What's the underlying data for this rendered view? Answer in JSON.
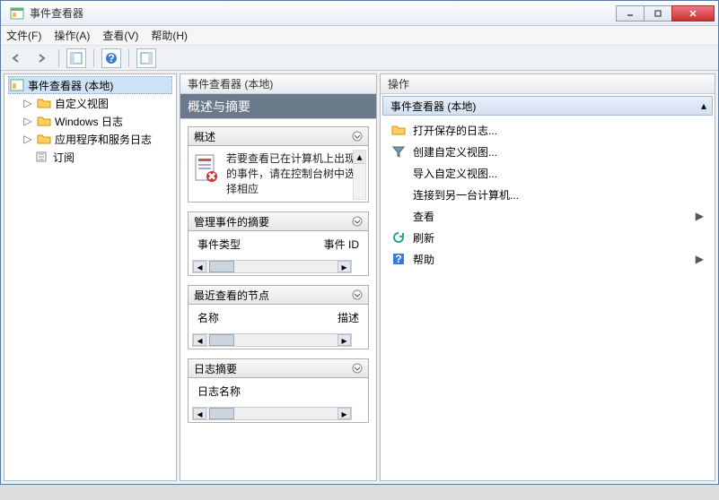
{
  "window": {
    "title": "事件查看器"
  },
  "menu": {
    "file": "文件(F)",
    "action": "操作(A)",
    "view": "查看(V)",
    "help": "帮助(H)"
  },
  "tree": {
    "root": "事件查看器 (本地)",
    "custom_views": "自定义视图",
    "windows_logs": "Windows 日志",
    "app_service_logs": "应用程序和服务日志",
    "subscriptions": "订阅"
  },
  "mid": {
    "header": "事件查看器 (本地)",
    "subheader": "概述与摘要",
    "overview": {
      "title": "概述",
      "text": "若要查看已在计算机上出现的事件，请在控制台树中选择相应"
    },
    "admin_summary": {
      "title": "管理事件的摘要",
      "col1": "事件类型",
      "col2": "事件 ID"
    },
    "recent_nodes": {
      "title": "最近查看的节点",
      "col1": "名称",
      "col2": "描述"
    },
    "log_summary": {
      "title": "日志摘要",
      "col1": "日志名称"
    }
  },
  "actions": {
    "header": "操作",
    "subheader": "事件查看器 (本地)",
    "open_saved": "打开保存的日志...",
    "create_custom": "创建自定义视图...",
    "import_custom": "导入自定义视图...",
    "connect": "连接到另一台计算机...",
    "view": "查看",
    "refresh": "刷新",
    "help": "帮助"
  }
}
